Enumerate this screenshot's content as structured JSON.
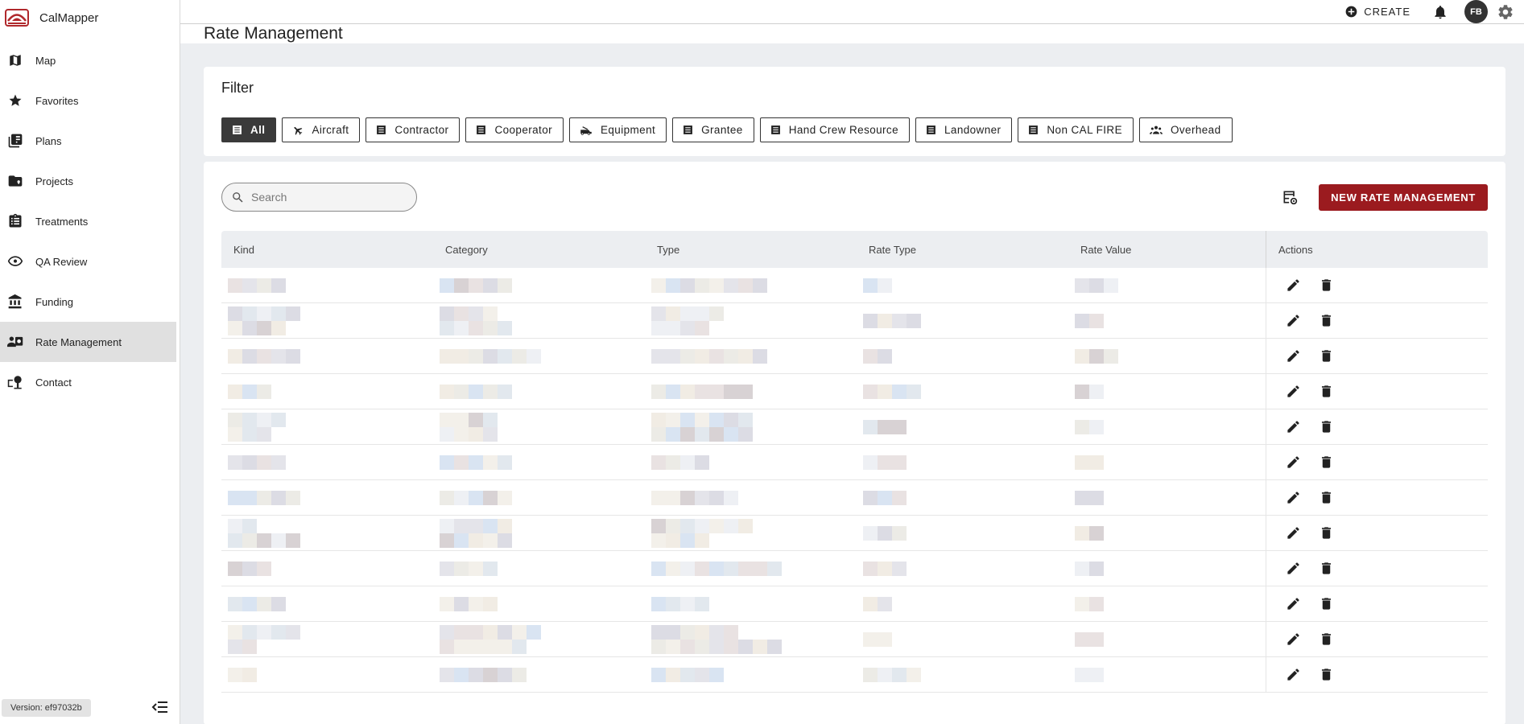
{
  "app": {
    "name": "CalMapper"
  },
  "sidebar": {
    "items": [
      {
        "label": "Map",
        "icon": "map-icon"
      },
      {
        "label": "Favorites",
        "icon": "star-icon"
      },
      {
        "label": "Plans",
        "icon": "plans-icon"
      },
      {
        "label": "Projects",
        "icon": "folder-pin-icon"
      },
      {
        "label": "Treatments",
        "icon": "clipboard-list-icon"
      },
      {
        "label": "QA Review",
        "icon": "eye-icon"
      },
      {
        "label": "Funding",
        "icon": "bank-icon"
      },
      {
        "label": "Rate Management",
        "icon": "rate-card-icon",
        "active": true
      },
      {
        "label": "Contact",
        "icon": "contact-icon"
      }
    ],
    "version": "Version: ef97032b"
  },
  "topbar": {
    "create_label": "CREATE",
    "avatar_initials": "FB"
  },
  "page": {
    "title": "Rate Management"
  },
  "filter": {
    "title": "Filter",
    "chips": [
      {
        "label": "All",
        "icon": "list-icon",
        "selected": true
      },
      {
        "label": "Aircraft",
        "icon": "airplane-icon"
      },
      {
        "label": "Contractor",
        "icon": "list-icon"
      },
      {
        "label": "Cooperator",
        "icon": "list-icon"
      },
      {
        "label": "Equipment",
        "icon": "vehicle-icon"
      },
      {
        "label": "Grantee",
        "icon": "list-icon"
      },
      {
        "label": "Hand Crew Resource",
        "icon": "list-icon"
      },
      {
        "label": "Landowner",
        "icon": "list-icon"
      },
      {
        "label": "Non CAL FIRE",
        "icon": "list-icon"
      },
      {
        "label": "Overhead",
        "icon": "group-icon"
      }
    ]
  },
  "table": {
    "search_placeholder": "Search",
    "new_button_label": "NEW RATE MANAGEMENT",
    "columns": [
      "Kind",
      "Category",
      "Type",
      "Rate Type",
      "Rate Value",
      "Actions"
    ],
    "row_count": 12
  },
  "colors": {
    "brand_red": "#9b1b1f",
    "selected_chip": "#3a3a3a",
    "header_bg": "#eceef1"
  }
}
